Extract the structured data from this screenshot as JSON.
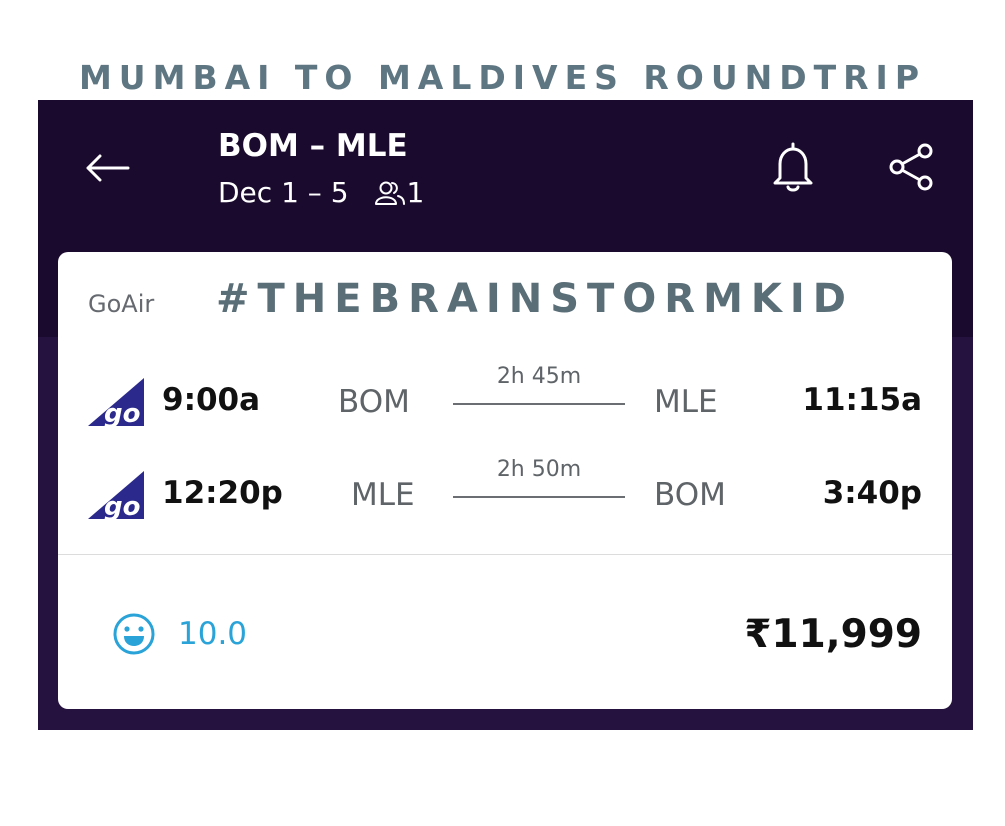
{
  "headline": "MUMBAI TO MALDIVES ROUNDTRIP",
  "header": {
    "route": "BOM – MLE",
    "dates": "Dec 1 – 5",
    "passengers": "1",
    "icons": [
      "back-arrow-icon",
      "passenger-icon",
      "bell-icon",
      "share-icon"
    ]
  },
  "card": {
    "airline": "GoAir",
    "watermark": "#THEBRAINSTORMKID",
    "legs": [
      {
        "depart_time": "9:00a",
        "from": "BOM",
        "duration": "2h 45m",
        "to": "MLE",
        "arrive_time": "11:15a"
      },
      {
        "depart_time": "12:20p",
        "from": "MLE",
        "duration": "2h 50m",
        "to": "BOM",
        "arrive_time": "3:40p"
      }
    ],
    "rating": "10.0",
    "price": "₹11,999"
  },
  "colors": {
    "header_bg": "#1a0a2e",
    "headline": "#5e7682",
    "rating": "#2aa3d8",
    "logo": "#2b2a8c"
  }
}
